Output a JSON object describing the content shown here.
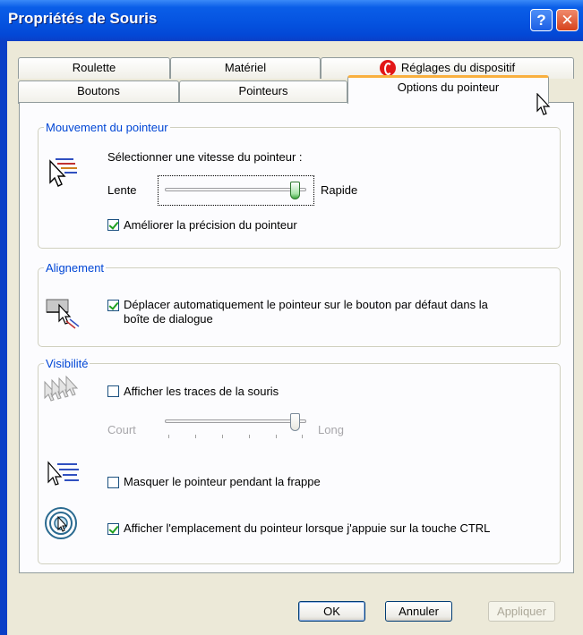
{
  "window": {
    "title": "Propriétés de Souris",
    "help_glyph": "?",
    "close_glyph": "✕"
  },
  "tabs": {
    "row1": [
      "Roulette",
      "Matériel",
      "Réglages du dispositif"
    ],
    "row2": [
      "Boutons",
      "Pointeurs",
      "Options du pointeur"
    ],
    "active": "Options du pointeur"
  },
  "motion": {
    "legend": "Mouvement du pointeur",
    "prompt": "Sélectionner une vitesse du pointeur :",
    "slow_label": "Lente",
    "fast_label": "Rapide",
    "speed_fraction": 0.95,
    "precision_label": "Améliorer la précision du pointeur",
    "precision_checked": true
  },
  "snap": {
    "legend": "Alignement",
    "label_line1": "Déplacer automatiquement le pointeur sur le bouton par défaut dans la",
    "label_line2": "boîte de dialogue",
    "checked": true
  },
  "visibility": {
    "legend": "Visibilité",
    "trails_label": "Afficher les traces de la souris",
    "trails_checked": false,
    "short_label": "Court",
    "long_label": "Long",
    "trail_fraction": 0.95,
    "hide_label": "Masquer le pointeur pendant la frappe",
    "hide_checked": false,
    "ctrl_label": "Afficher l'emplacement du pointeur lorsque j'appuie sur la touche CTRL",
    "ctrl_checked": true
  },
  "buttons": {
    "ok": "OK",
    "cancel": "Annuler",
    "apply": "Appliquer"
  },
  "colors": {
    "titlebar": "#0553e0",
    "legend_text": "#0046d5",
    "active_tab_accent": "#f9b03e"
  }
}
